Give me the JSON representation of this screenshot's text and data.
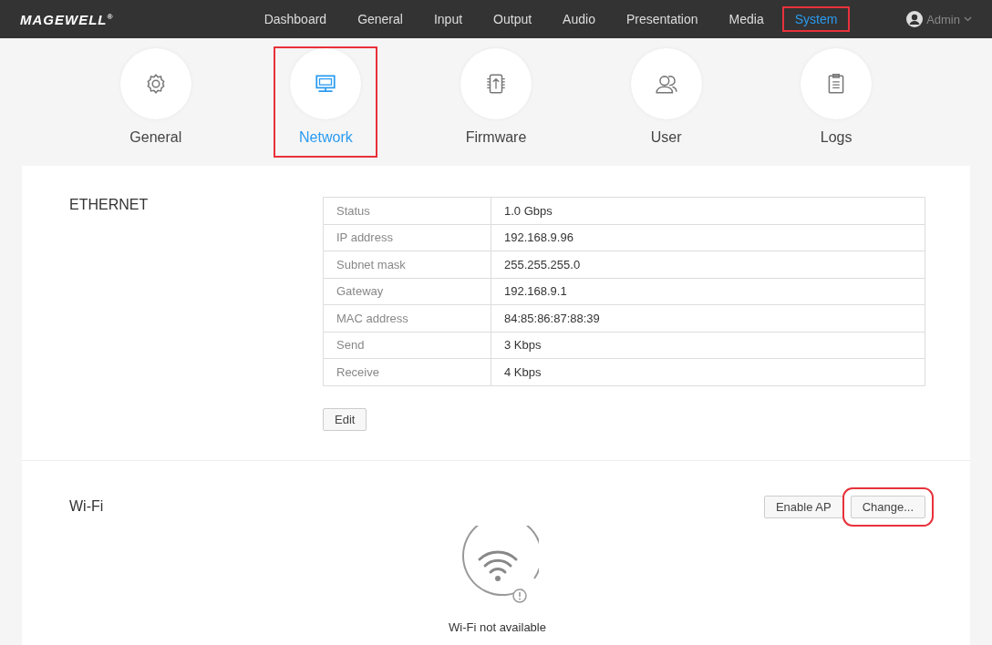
{
  "header": {
    "logo": "MAGEWELL",
    "logo_mark": "®",
    "nav": [
      {
        "label": "Dashboard",
        "selected": false,
        "highlighted": false
      },
      {
        "label": "General",
        "selected": false,
        "highlighted": false
      },
      {
        "label": "Input",
        "selected": false,
        "highlighted": false
      },
      {
        "label": "Output",
        "selected": false,
        "highlighted": false
      },
      {
        "label": "Audio",
        "selected": false,
        "highlighted": false
      },
      {
        "label": "Presentation",
        "selected": false,
        "highlighted": false
      },
      {
        "label": "Media",
        "selected": false,
        "highlighted": false
      },
      {
        "label": "System",
        "selected": true,
        "highlighted": true
      }
    ],
    "user": "Admin"
  },
  "subnav": [
    {
      "label": "General",
      "kind": "gear",
      "selected": false,
      "highlighted": false
    },
    {
      "label": "Network",
      "kind": "monitor",
      "selected": true,
      "highlighted": true
    },
    {
      "label": "Firmware",
      "kind": "chip",
      "selected": false,
      "highlighted": false
    },
    {
      "label": "User",
      "kind": "people",
      "selected": false,
      "highlighted": false
    },
    {
      "label": "Logs",
      "kind": "clipboard",
      "selected": false,
      "highlighted": false
    }
  ],
  "ethernet": {
    "title": "ETHERNET",
    "rows": [
      {
        "label": "Status",
        "value": "1.0 Gbps"
      },
      {
        "label": "IP address",
        "value": "192.168.9.96"
      },
      {
        "label": "Subnet mask",
        "value": "255.255.255.0"
      },
      {
        "label": "Gateway",
        "value": "192.168.9.1"
      },
      {
        "label": "MAC address",
        "value": "84:85:86:87:88:39"
      },
      {
        "label": "Send",
        "value": "3 Kbps"
      },
      {
        "label": "Receive",
        "value": "4 Kbps"
      }
    ],
    "button": "Edit"
  },
  "wifi": {
    "title": "Wi-Fi",
    "buttons": [
      {
        "label": "Enable AP",
        "highlighted": false
      },
      {
        "label": "Change...",
        "highlighted": true
      }
    ],
    "status": "Wi-Fi not available"
  }
}
